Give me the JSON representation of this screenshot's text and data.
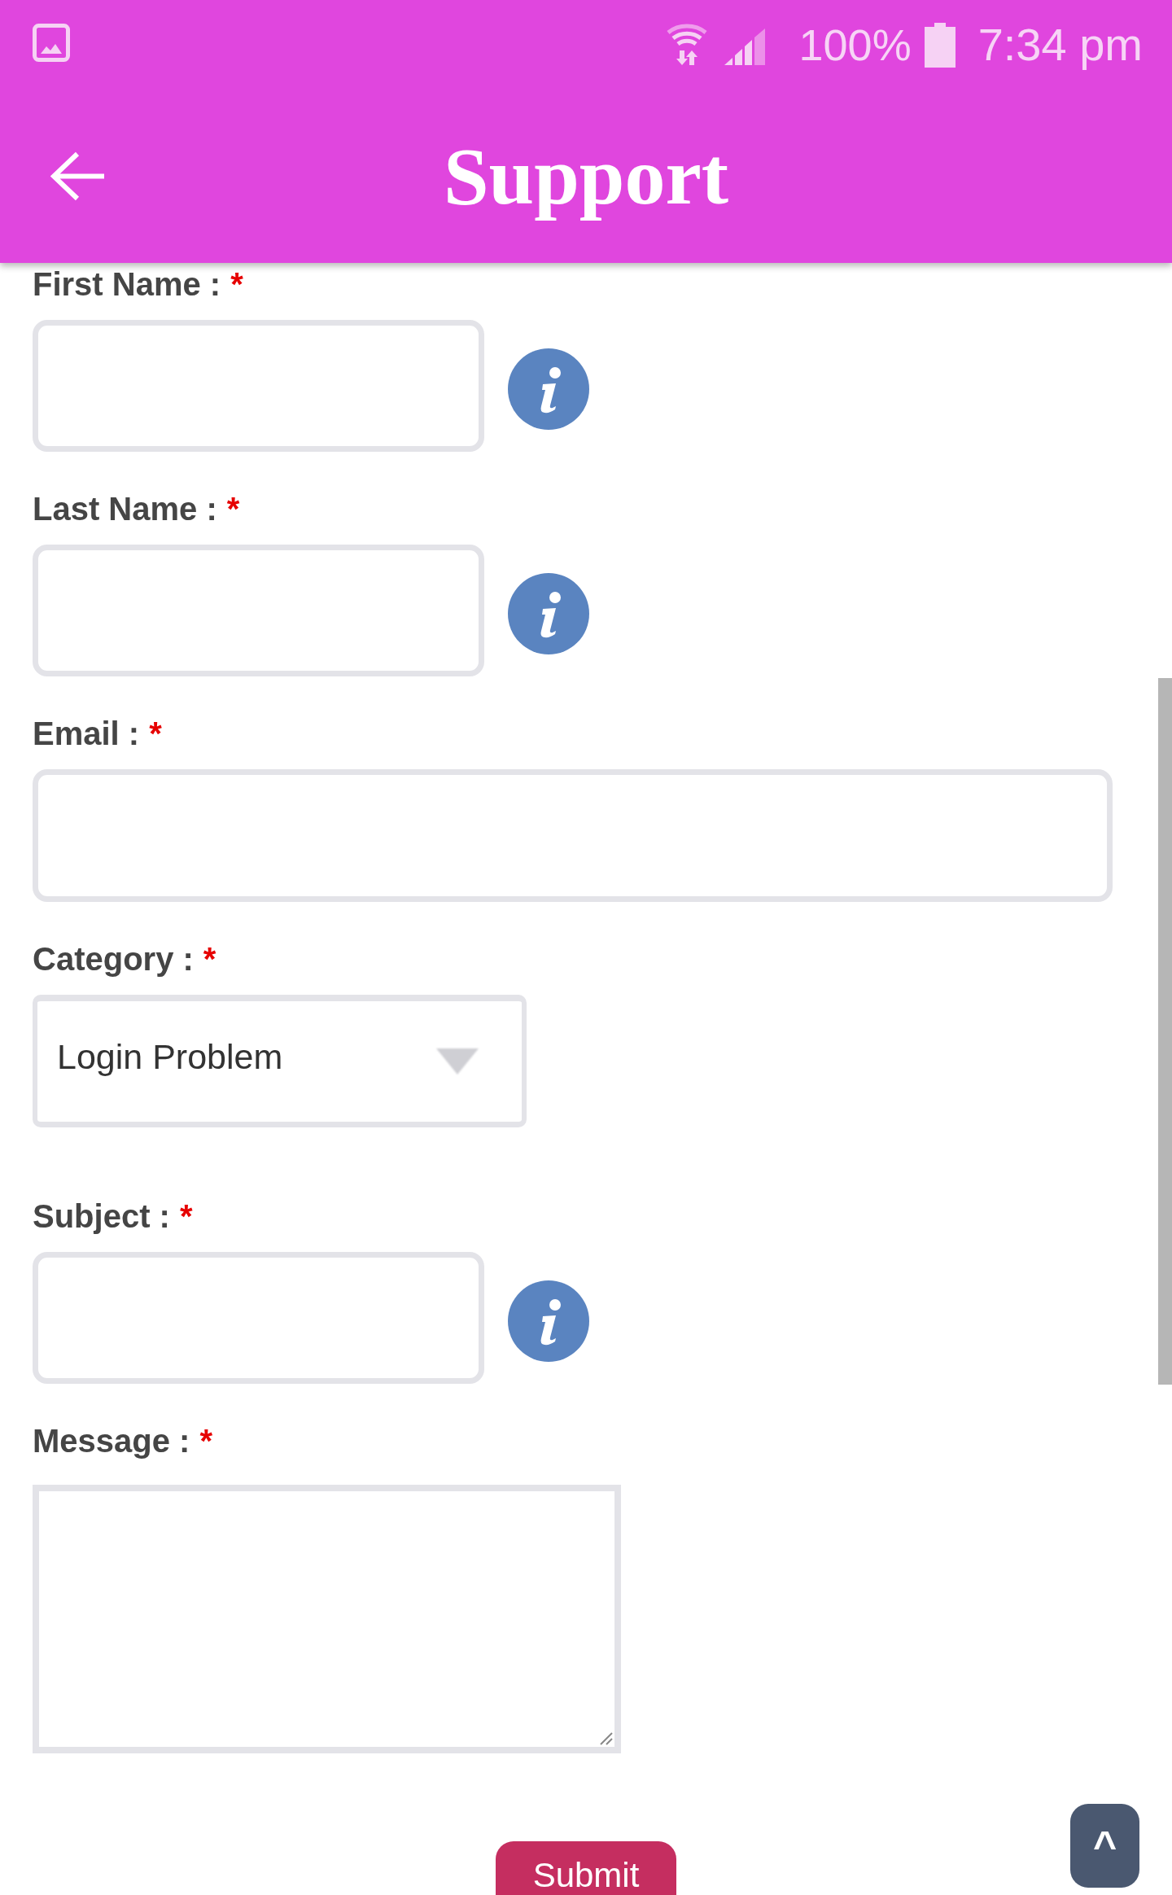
{
  "status_bar": {
    "battery": "100%",
    "time": "7:34 pm"
  },
  "app_bar": {
    "title": "Support"
  },
  "form": {
    "fields": [
      {
        "kind": "text",
        "label": "First Name :",
        "required_mark": "*",
        "info_button": true
      },
      {
        "kind": "text",
        "label": "Last Name :",
        "required_mark": "*",
        "info_button": true
      },
      {
        "kind": "email",
        "label": "Email :",
        "required_mark": "*",
        "info_button": false
      },
      {
        "kind": "select",
        "label": "Category :",
        "required_mark": "*",
        "value": "Login Problem",
        "info_button": false
      },
      {
        "kind": "text",
        "label": "Subject :",
        "required_mark": "*",
        "info_button": true
      },
      {
        "kind": "textarea",
        "label": "Message :",
        "required_mark": "*",
        "info_button": false
      }
    ]
  },
  "submit_button": {
    "label": "Submit"
  },
  "scroll_top_button": {
    "label": "^"
  }
}
